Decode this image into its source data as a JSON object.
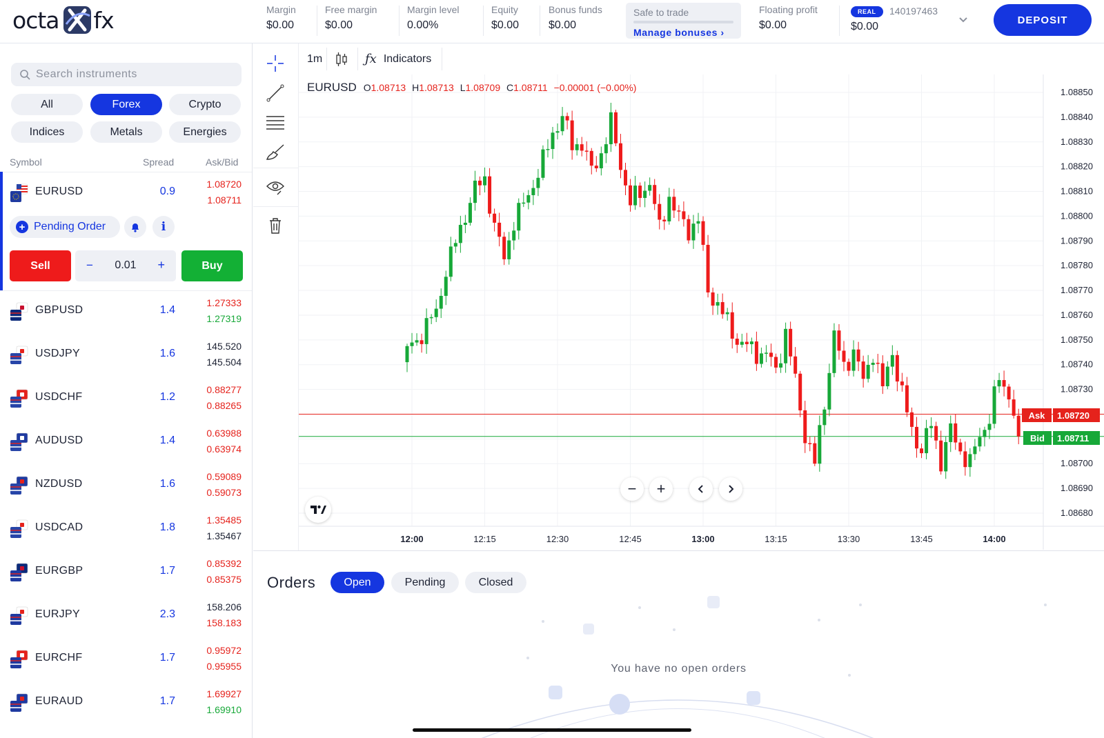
{
  "brand": {
    "logo_left": "octa",
    "logo_right": "fx"
  },
  "header": {
    "stats": [
      {
        "label": "Margin",
        "value": "$0.00"
      },
      {
        "label": "Free margin",
        "value": "$0.00"
      },
      {
        "label": "Margin level",
        "value": "0.00%"
      },
      {
        "label": "Equity",
        "value": "$0.00"
      },
      {
        "label": "Bonus funds",
        "value": "$0.00"
      }
    ],
    "safe_label": "Safe to trade",
    "manage_bonuses": "Manage bonuses",
    "floating_label": "Floating profit",
    "floating_value": "$0.00",
    "account_badge": "REAL",
    "account_number": "140197463",
    "account_balance": "$0.00",
    "deposit": "DEPOSIT"
  },
  "sidebar": {
    "search_placeholder": "Search instruments",
    "categories": [
      "All",
      "Forex",
      "Crypto",
      "Indices",
      "Metals",
      "Energies"
    ],
    "active_category": "Forex",
    "columns": {
      "symbol": "Symbol",
      "spread": "Spread",
      "askbid": "Ask/Bid"
    },
    "instruments": [
      {
        "symbol": "EURUSD",
        "spread": "0.9",
        "ask": "1.08720",
        "bid": "1.08711",
        "ask_color": "red",
        "bid_color": "red"
      },
      {
        "symbol": "GBPUSD",
        "spread": "1.4",
        "ask": "1.27333",
        "bid": "1.27319",
        "ask_color": "red",
        "bid_color": "green"
      },
      {
        "symbol": "USDJPY",
        "spread": "1.6",
        "ask": "145.520",
        "bid": "145.504",
        "ask_color": "black",
        "bid_color": "black"
      },
      {
        "symbol": "USDCHF",
        "spread": "1.2",
        "ask": "0.88277",
        "bid": "0.88265",
        "ask_color": "red",
        "bid_color": "red"
      },
      {
        "symbol": "AUDUSD",
        "spread": "1.4",
        "ask": "0.63988",
        "bid": "0.63974",
        "ask_color": "red",
        "bid_color": "red"
      },
      {
        "symbol": "NZDUSD",
        "spread": "1.6",
        "ask": "0.59089",
        "bid": "0.59073",
        "ask_color": "red",
        "bid_color": "red"
      },
      {
        "symbol": "USDCAD",
        "spread": "1.8",
        "ask": "1.35485",
        "bid": "1.35467",
        "ask_color": "red",
        "bid_color": "black"
      },
      {
        "symbol": "EURGBP",
        "spread": "1.7",
        "ask": "0.85392",
        "bid": "0.85375",
        "ask_color": "red",
        "bid_color": "red"
      },
      {
        "symbol": "EURJPY",
        "spread": "2.3",
        "ask": "158.206",
        "bid": "158.183",
        "ask_color": "black",
        "bid_color": "red"
      },
      {
        "symbol": "EURCHF",
        "spread": "1.7",
        "ask": "0.95972",
        "bid": "0.95955",
        "ask_color": "red",
        "bid_color": "red"
      },
      {
        "symbol": "EURAUD",
        "spread": "1.7",
        "ask": "1.69927",
        "bid": "1.69910",
        "ask_color": "red",
        "bid_color": "green"
      }
    ],
    "pending_order": "Pending Order",
    "sell": "Sell",
    "buy": "Buy",
    "lot_minus": "−",
    "lot_value": "0.01",
    "lot_plus": "+"
  },
  "chart_toolbar": {
    "timeframe": "1m",
    "indicators": "Indicators"
  },
  "chart_legend": {
    "symbol": "EURUSD",
    "o_label": "O",
    "o": "1.08713",
    "h_label": "H",
    "h": "1.08713",
    "l_label": "L",
    "l": "1.08709",
    "c_label": "C",
    "c": "1.08711",
    "change": "−0.00001 (−0.00%)"
  },
  "chart_data": {
    "type": "candlestick",
    "symbol": "EURUSD",
    "interval": "1m",
    "x_ticks": [
      "12:00",
      "12:15",
      "12:30",
      "12:45",
      "13:00",
      "13:15",
      "13:30",
      "13:45",
      "14:00"
    ],
    "y_ticks": [
      "1.08850",
      "1.08840",
      "1.08830",
      "1.08820",
      "1.08810",
      "1.08800",
      "1.08790",
      "1.08780",
      "1.08770",
      "1.08760",
      "1.08750",
      "1.08740",
      "1.08730",
      "1.08720",
      "1.08710",
      "1.08700",
      "1.08690",
      "1.08680"
    ],
    "ylim": [
      1.0868,
      1.0885
    ],
    "ask_label": "Ask",
    "ask_price": "1.08720",
    "bid_label": "Bid",
    "bid_price": "1.08711",
    "up_color": "#17a838",
    "down_color": "#ee1b1b",
    "close_path": [
      1.08745,
      1.0875,
      1.08755,
      1.08763,
      1.08778,
      1.0879,
      1.088,
      1.0881,
      1.08816,
      1.08795,
      1.08785,
      1.08797,
      1.08805,
      1.08812,
      1.08822,
      1.08835,
      1.0884,
      1.0883,
      1.08828,
      1.08818,
      1.08825,
      1.08838,
      1.08822,
      1.08805,
      1.0881,
      1.08812,
      1.08795,
      1.08808,
      1.088,
      1.08795,
      1.08798,
      1.0877,
      1.08763,
      1.08758,
      1.0875,
      1.08748,
      1.08745,
      1.08743,
      1.08738,
      1.08752,
      1.08735,
      1.08712,
      1.087,
      1.08725,
      1.0875,
      1.0874,
      1.08745,
      1.08735,
      1.08745,
      1.0873,
      1.08745,
      1.08727,
      1.08715,
      1.08705,
      1.08717,
      1.087,
      1.08713,
      1.08705,
      1.087,
      1.08713,
      1.08718,
      1.08735,
      1.08727,
      1.08711
    ]
  },
  "orders": {
    "title": "Orders",
    "tabs": [
      "Open",
      "Pending",
      "Closed"
    ],
    "active_tab": "Open",
    "empty_message": "You have no open orders"
  },
  "colors": {
    "accent": "#1536e0",
    "sell": "#ee1b1b",
    "buy": "#13b035",
    "ask_line": "#e5221c",
    "bid_line": "#17a838"
  }
}
